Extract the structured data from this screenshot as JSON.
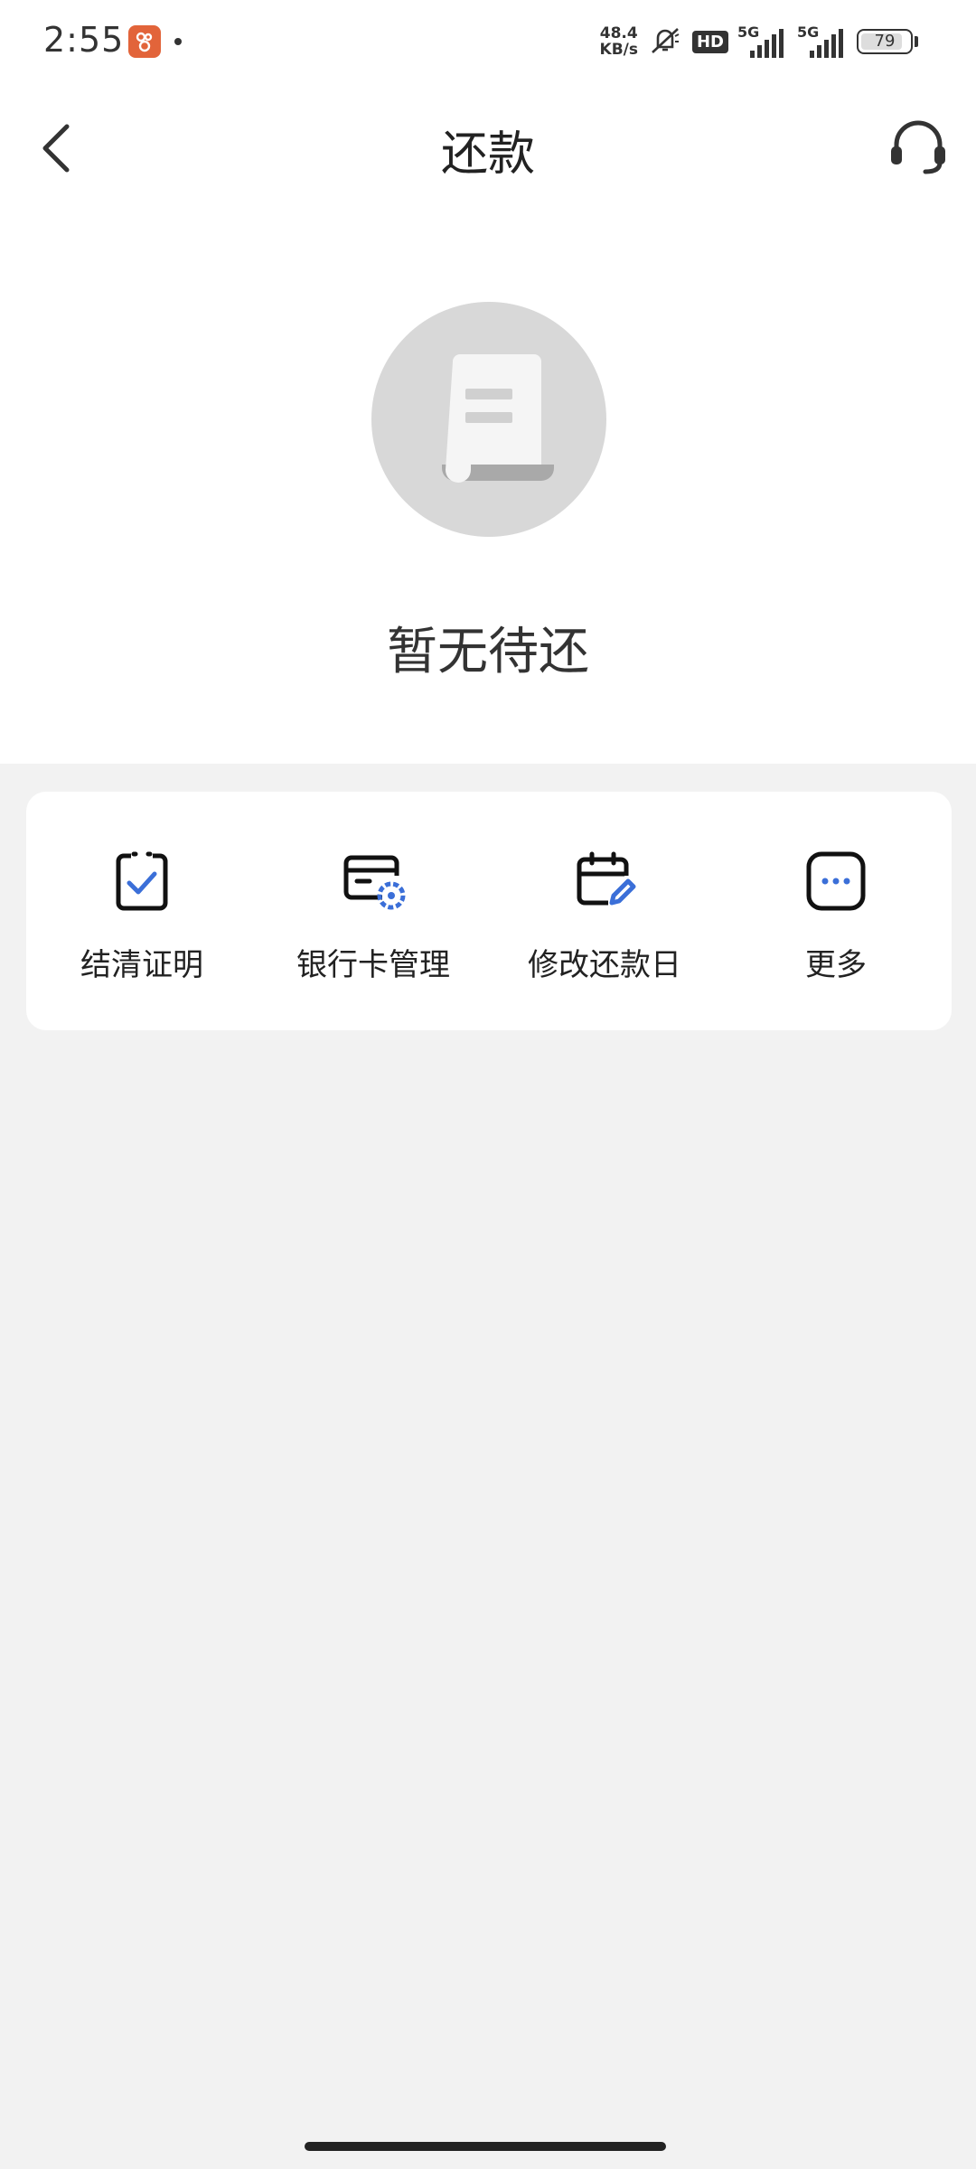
{
  "status_bar": {
    "time": "2:55",
    "net_speed_value": "48.4",
    "net_speed_unit": "KB/s",
    "hd_label": "HD",
    "signal1_label": "5G",
    "signal2_label": "5G",
    "battery_level": "79",
    "icons": [
      "app-notification-icon",
      "mute-icon",
      "signal-icon",
      "battery-icon"
    ]
  },
  "header": {
    "title": "还款",
    "back_icon": "chevron-left-icon",
    "service_icon": "headset-icon"
  },
  "empty_state": {
    "icon": "document-icon",
    "text": "暂无待还"
  },
  "actions": {
    "items": [
      {
        "label": "结清证明",
        "icon": "clipboard-check-icon"
      },
      {
        "label": "银行卡管理",
        "icon": "card-settings-icon"
      },
      {
        "label": "修改还款日",
        "icon": "calendar-edit-icon"
      },
      {
        "label": "更多",
        "icon": "more-icon"
      }
    ]
  },
  "colors": {
    "accent": "#3b6fd8",
    "background": "#f2f2f2",
    "card": "#ffffff",
    "illustration": "#d8d8d8"
  }
}
